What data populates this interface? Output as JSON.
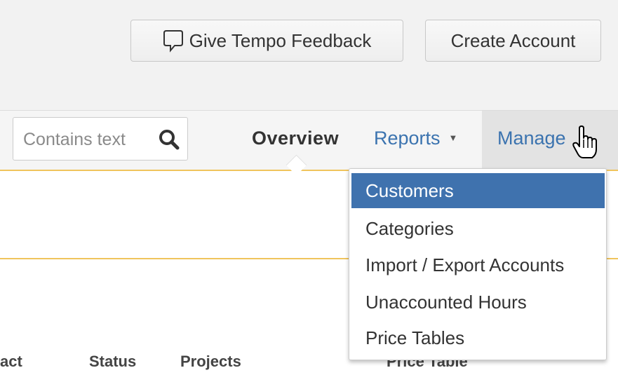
{
  "header": {
    "feedback_label": "Give Tempo Feedback",
    "create_account_label": "Create Account"
  },
  "search": {
    "placeholder": "Contains text"
  },
  "nav": {
    "overview": "Overview",
    "reports": "Reports",
    "manage": "Manage"
  },
  "manage_menu": {
    "items": [
      "Customers",
      "Categories",
      "Import / Export Accounts",
      "Unaccounted Hours",
      "Price Tables"
    ],
    "active": "Customers"
  },
  "table": {
    "columns": [
      "act",
      "Status",
      "Projects",
      "Price Table"
    ]
  },
  "icons": {
    "feedback": "speech-bubble-icon",
    "search": "magnifier-icon",
    "reports_caret": "caret-down-icon",
    "cursor": "hand-pointer-icon"
  },
  "colors": {
    "accent": "#3f72ae",
    "link": "#3b73af",
    "underline": "#f0c45c"
  }
}
